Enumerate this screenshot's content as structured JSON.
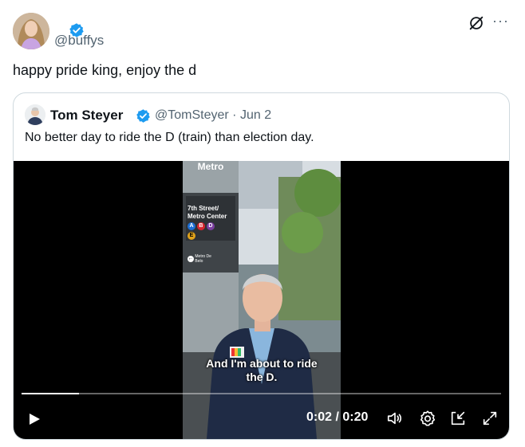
{
  "author": {
    "handle": "@buffys",
    "avatar_icon": "profile-photo"
  },
  "tweet": {
    "text": "happy pride king, enjoy the d"
  },
  "quoted": {
    "name": "Tom Steyer",
    "handle": "@TomSteyer",
    "separator": "·",
    "date": "Jun 2",
    "text": "No better day to ride the D (train) than election day.",
    "video": {
      "caption_line1": "And I'm about to ride",
      "caption_line2": "the D.",
      "time": "0:02 / 0:20",
      "progress": 0.12,
      "sign": {
        "title": "Metro",
        "station_line1": "7th Street/",
        "station_line2": "Metro Center",
        "lines": [
          "A",
          "B",
          "D",
          "E"
        ],
        "arrow_text_line1": "Metro De",
        "arrow_text_line2": "Belo"
      }
    }
  },
  "colors": {
    "verified": "#1d9bf0",
    "secondary_text": "#536471",
    "border": "#cfd9de"
  },
  "icons": {
    "more": "more-icon",
    "grok": "grok-icon",
    "play": "play-icon",
    "volume": "volume-icon",
    "settings": "settings-icon",
    "pip": "picture-in-picture-icon",
    "fullscreen": "fullscreen-icon"
  }
}
